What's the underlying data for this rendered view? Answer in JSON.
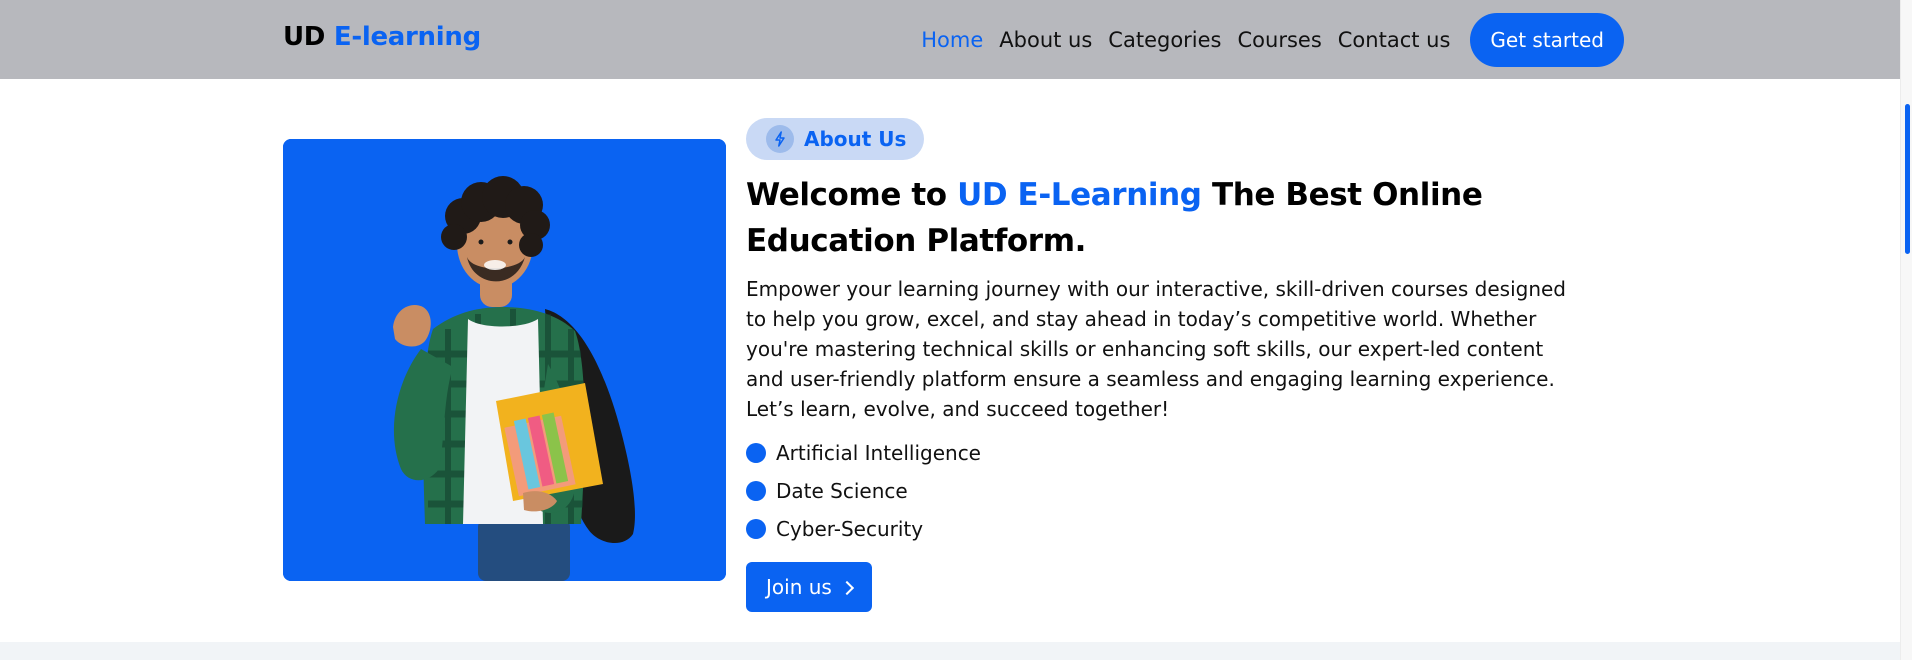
{
  "header": {
    "logo": {
      "part1": "UD",
      "part2": "E-learning"
    },
    "nav": [
      {
        "label": "Home",
        "active": true
      },
      {
        "label": "About us",
        "active": false
      },
      {
        "label": "Categories",
        "active": false
      },
      {
        "label": "Courses",
        "active": false
      },
      {
        "label": "Contact us",
        "active": false
      }
    ],
    "cta_label": "Get started"
  },
  "hero": {
    "image_icon": "student-photo",
    "pill_icon": "lightning-icon",
    "pill_label": "About Us",
    "headline": {
      "prefix": "Welcome to",
      "brand": "UD E-Learning",
      "suffix": "The Best Online Education Platform."
    },
    "paragraph": "Empower your learning journey with our interactive, skill-driven courses designed to help you grow, excel, and stay ahead in today’s competitive world. Whether you're mastering technical skills or enhancing soft skills, our expert-led content and user-friendly platform ensure a seamless and engaging learning experience. Let’s learn, evolve, and succeed together!",
    "features": [
      "Artificial Intelligence",
      "Date Science",
      "Cyber-Security"
    ],
    "cta_label": "Join us",
    "cta_icon": "chevron-right-icon"
  },
  "colors": {
    "brand": "#0a63f2",
    "header_bg": "#b7b8bd",
    "pill_bg": "#c9d9f5"
  }
}
